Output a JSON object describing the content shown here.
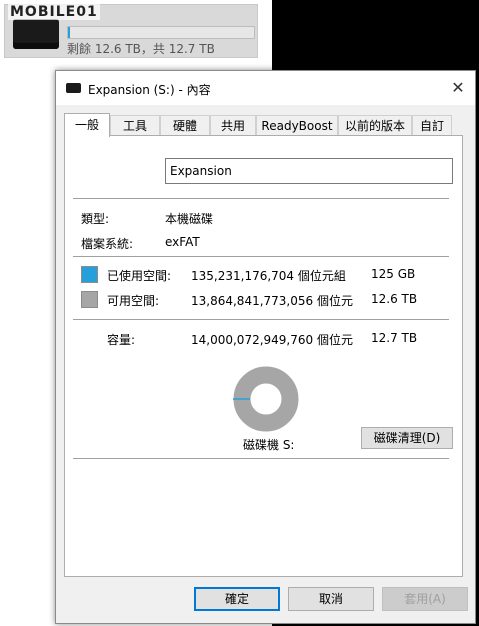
{
  "explorer": {
    "logo_text": "MOBILE01",
    "drive_label": "剩餘 12.6 TB，共 12.7 TB",
    "used_fraction": 0.01
  },
  "dialog": {
    "title": "Expansion (S:) - 內容",
    "close_glyph": "✕",
    "tabs": [
      "一般",
      "工具",
      "硬體",
      "共用",
      "ReadyBoost",
      "以前的版本",
      "自訂"
    ],
    "active_tab": "一般",
    "name_value": "Expansion",
    "type_label": "類型:",
    "type_value": "本機磁碟",
    "fs_label": "檔案系統:",
    "fs_value": "exFAT",
    "used": {
      "label": "已使用空間:",
      "bytes": "135,231,176,704 個位元組",
      "size": "125 GB",
      "color": "#26a0da"
    },
    "free": {
      "label": "可用空間:",
      "bytes": "13,864,841,773,056 個位元",
      "size": "12.6 TB",
      "color": "#a6a6a6"
    },
    "capacity": {
      "label": "容量:",
      "bytes": "14,000,072,949,760 個位元",
      "size": "12.7 TB"
    },
    "drive_caption": "磁碟機 S:",
    "cleanup_label": "磁碟清理(D)",
    "ok_label": "確定",
    "cancel_label": "取消",
    "apply_label": "套用(A)"
  }
}
